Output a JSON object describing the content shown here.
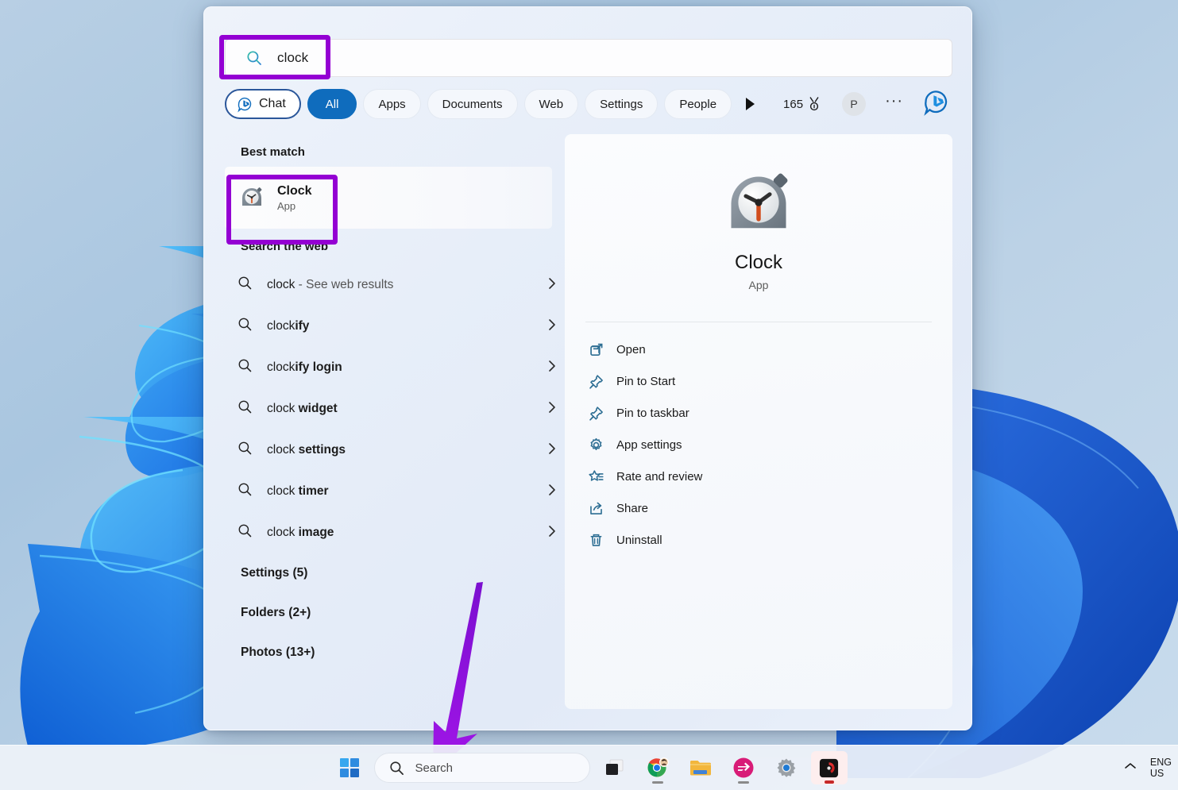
{
  "search": {
    "query": "clock",
    "icon": "search-icon"
  },
  "filters": {
    "chat": "Chat",
    "items": [
      "All",
      "Apps",
      "Documents",
      "Web",
      "Settings",
      "People"
    ],
    "active": "All",
    "play_icon": "play-triangle-icon",
    "rewards_points": "165",
    "rewards_icon": "rewards-medal-icon",
    "avatar_initial": "P",
    "overflow": "···",
    "bing_icon": "bing-chat-icon"
  },
  "left": {
    "best_match_heading": "Best match",
    "best_match": {
      "title": "Clock",
      "subtitle": "App",
      "icon": "clock-app-icon"
    },
    "web_heading": "Search the web",
    "web_results": [
      {
        "prefix": "clock",
        "suffix": " - See web results",
        "suffix_dim": true,
        "chevron": "chevron-right-icon"
      },
      {
        "prefix": "clock",
        "suffix": "ify",
        "suffix_dim": false,
        "chevron": "chevron-right-icon"
      },
      {
        "prefix": "clock",
        "suffix": "ify login",
        "suffix_dim": false,
        "chevron": "chevron-right-icon"
      },
      {
        "prefix": "clock ",
        "suffix": "widget",
        "suffix_dim": false,
        "chevron": "chevron-right-icon"
      },
      {
        "prefix": "clock ",
        "suffix": "settings",
        "suffix_dim": false,
        "chevron": "chevron-right-icon"
      },
      {
        "prefix": "clock ",
        "suffix": "timer",
        "suffix_dim": false,
        "chevron": "chevron-right-icon"
      },
      {
        "prefix": "clock ",
        "suffix": "image",
        "suffix_dim": false,
        "chevron": "chevron-right-icon"
      }
    ],
    "categories": [
      "Settings (5)",
      "Folders (2+)",
      "Photos (13+)"
    ]
  },
  "preview": {
    "icon": "clock-app-icon-large",
    "title": "Clock",
    "subtitle": "App",
    "actions": [
      {
        "label": "Open",
        "icon": "open-external-icon"
      },
      {
        "label": "Pin to Start",
        "icon": "pin-icon"
      },
      {
        "label": "Pin to taskbar",
        "icon": "pin-icon"
      },
      {
        "label": "App settings",
        "icon": "gear-icon"
      },
      {
        "label": "Rate and review",
        "icon": "star-list-icon"
      },
      {
        "label": "Share",
        "icon": "share-icon"
      },
      {
        "label": "Uninstall",
        "icon": "trash-icon"
      }
    ]
  },
  "taskbar": {
    "start_icon": "windows-start-icon",
    "search_placeholder": "Search",
    "search_icon": "search-icon",
    "apps": [
      {
        "name": "task-view",
        "icon": "task-view-icon",
        "running": false
      },
      {
        "name": "chrome",
        "icon": "chrome-icon",
        "running": true
      },
      {
        "name": "file-explorer",
        "icon": "folder-icon",
        "running": false
      },
      {
        "name": "media-app",
        "icon": "pink-media-icon",
        "running": true
      },
      {
        "name": "settings",
        "icon": "gear-icon",
        "running": false
      },
      {
        "name": "recorder",
        "icon": "recorder-icon",
        "running": true,
        "active": true
      }
    ],
    "tray": {
      "chevron": "chevron-up-icon",
      "language_line1": "ENG",
      "language_line2": "US"
    }
  },
  "annotations": {
    "highlight_color": "#9400d3",
    "arrow_color": "#8a0fd6",
    "highlight_search_box": "search-input",
    "highlight_best_match": "best-match-row",
    "arrow_points_to": "taskbar-search"
  }
}
